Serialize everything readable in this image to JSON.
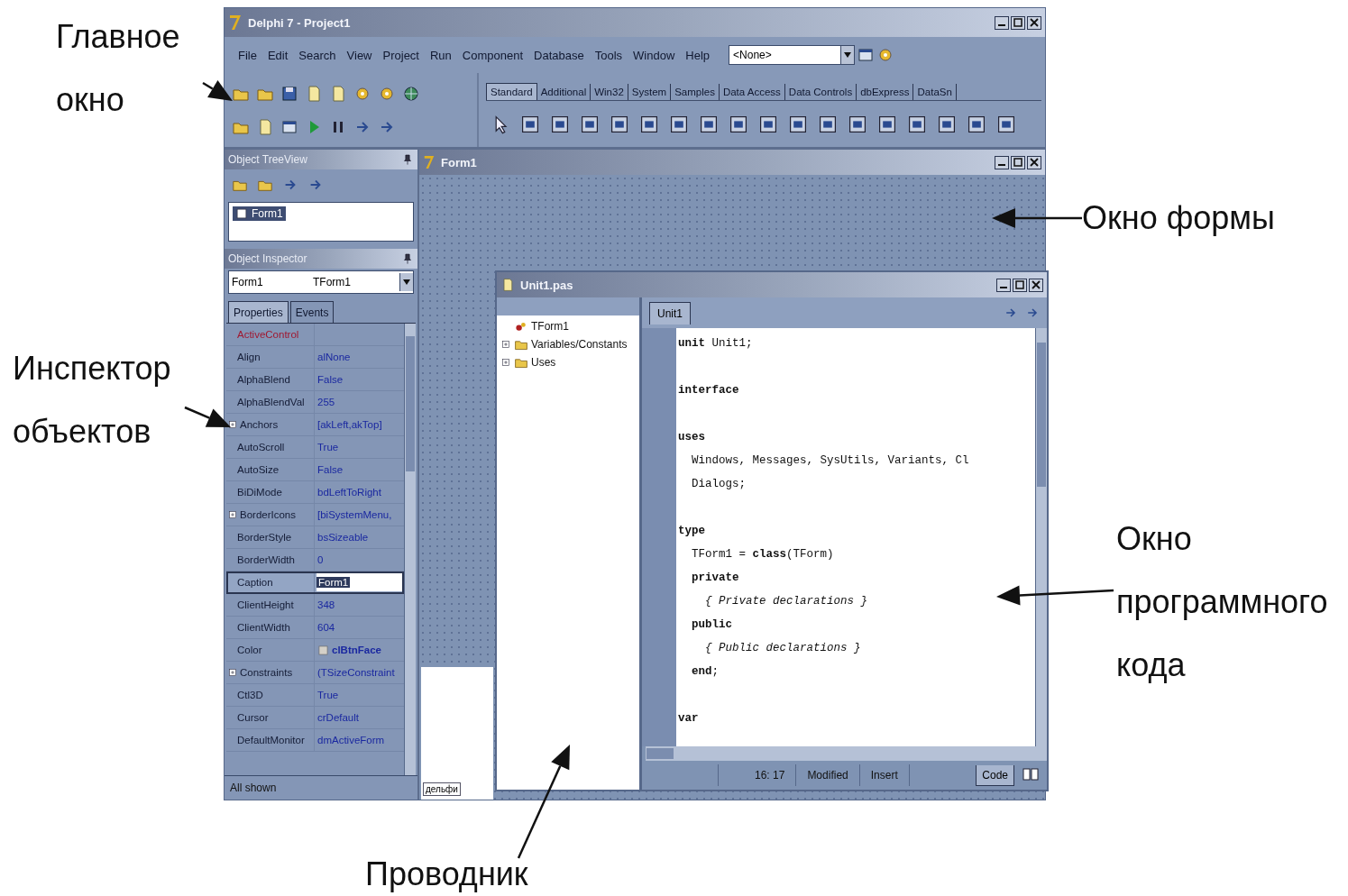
{
  "callouts": [
    {
      "text": "Главное окно",
      "stacked": true
    },
    {
      "text": "Инспектор объектов",
      "stacked": true
    },
    {
      "text": "Окно формы",
      "stacked": false
    },
    {
      "text": "Окно программного кода",
      "stacked": true
    },
    {
      "text": "Проводник"
    }
  ],
  "main_window": {
    "title": "Delphi 7 - Project1",
    "menu": [
      "File",
      "Edit",
      "Search",
      "View",
      "Project",
      "Run",
      "Component",
      "Database",
      "Tools",
      "Window",
      "Help"
    ],
    "combo": "<None>",
    "palette_tabs": [
      {
        "label": "Standard",
        "selected": true
      },
      {
        "label": "Additional",
        "selected": false
      },
      {
        "label": "Win32",
        "selected": false
      },
      {
        "label": "System",
        "selected": false
      },
      {
        "label": "Samples",
        "selected": false
      },
      {
        "label": "Data Access",
        "selected": false
      },
      {
        "label": "Data Controls",
        "selected": false
      },
      {
        "label": "dbExpress",
        "selected": false
      },
      {
        "label": "DataSn",
        "selected": false
      }
    ]
  },
  "tree_view": {
    "title": "Object TreeView",
    "items": [
      {
        "label": "Form1",
        "selected": true
      }
    ]
  },
  "inspector": {
    "title": "Object Inspector",
    "object": "Form1",
    "object_type": "TForm1",
    "tabs": [
      {
        "label": "Properties",
        "selected": true
      },
      {
        "label": "Events",
        "selected": false
      }
    ],
    "properties": [
      {
        "name": "ActiveControl",
        "kind": "reference",
        "has_children": false,
        "selected": false
      },
      {
        "name": "Align",
        "value": "alNone",
        "kind": "plain",
        "has_children": false,
        "selected": false
      },
      {
        "name": "AlphaBlend",
        "value": "False",
        "kind": "plain",
        "has_children": false,
        "selected": false
      },
      {
        "name": "AlphaBlendVal",
        "value": "255",
        "kind": "plain",
        "has_children": false,
        "selected": false
      },
      {
        "name": "Anchors",
        "value": "[akLeft,akTop]",
        "kind": "plain",
        "has_children": true,
        "selected": false
      },
      {
        "name": "AutoScroll",
        "value": "True",
        "kind": "plain",
        "has_children": false,
        "selected": false
      },
      {
        "name": "AutoSize",
        "value": "False",
        "kind": "plain",
        "has_children": false,
        "selected": false
      },
      {
        "name": "BiDiMode",
        "value": "bdLeftToRight",
        "kind": "plain",
        "has_children": false,
        "selected": false
      },
      {
        "name": "BorderIcons",
        "value": "[biSystemMenu,",
        "kind": "plain",
        "has_children": true,
        "selected": false
      },
      {
        "name": "BorderStyle",
        "value": "bsSizeable",
        "kind": "plain",
        "has_children": false,
        "selected": false
      },
      {
        "name": "BorderWidth",
        "value": "0",
        "kind": "plain",
        "has_children": false,
        "selected": false
      },
      {
        "name": "Caption",
        "value": "Form1",
        "kind": "plain",
        "has_children": false,
        "selected": true
      },
      {
        "name": "ClientHeight",
        "value": "348",
        "kind": "plain",
        "has_children": false,
        "selected": false
      },
      {
        "name": "ClientWidth",
        "value": "604",
        "kind": "plain",
        "has_children": false,
        "selected": false
      },
      {
        "name": "Color",
        "value": "clBtnFace",
        "kind": "color",
        "has_children": false,
        "selected": false
      },
      {
        "name": "Constraints",
        "value": "(TSizeConstraint",
        "kind": "plain",
        "has_children": true,
        "selected": false
      },
      {
        "name": "Ctl3D",
        "value": "True",
        "kind": "plain",
        "has_children": false,
        "selected": false
      },
      {
        "name": "Cursor",
        "value": "crDefault",
        "kind": "plain",
        "has_children": false,
        "selected": false
      },
      {
        "name": "DefaultMonitor",
        "value": "dmActiveForm",
        "kind": "plain",
        "has_children": false,
        "selected": false
      }
    ],
    "status": "All shown"
  },
  "form_window": {
    "title": "Form1",
    "background_tab": "дельфи"
  },
  "editor": {
    "title": "Unit1.pas",
    "explorer": [
      {
        "label": "TForm1",
        "has_children": false
      },
      {
        "label": "Variables/Constants",
        "has_children": true
      },
      {
        "label": "Uses",
        "has_children": true
      }
    ],
    "tabs": [
      {
        "label": "Unit1",
        "selected": true
      }
    ],
    "code_blocks": [
      [
        {
          "text": "**unit** Unit1;",
          "kind": "code"
        }
      ],
      [
        {
          "text": "**interface**",
          "kind": "code"
        }
      ],
      [
        {
          "text": "**uses**",
          "kind": "code"
        },
        {
          "text": "  Windows, Messages, SysUtils, Variants, Cl",
          "kind": "code"
        },
        {
          "text": "  Dialogs;",
          "kind": "code"
        }
      ],
      [
        {
          "text": "**type**",
          "kind": "code"
        },
        {
          "text": "  TForm1 = **class**(TForm)",
          "kind": "code"
        },
        {
          "text": "  **private**",
          "kind": "code"
        },
        {
          "text": "    { Private declarations }",
          "kind": "comment"
        },
        {
          "text": "  **public**",
          "kind": "code"
        },
        {
          "text": "    { Public declarations }",
          "kind": "comment"
        },
        {
          "text": "  **end**;",
          "kind": "code"
        }
      ],
      [
        {
          "text": "**var**",
          "kind": "code"
        }
      ]
    ],
    "status": {
      "position": "16: 17",
      "modified": "Modified",
      "mode": "Insert"
    },
    "view_tabs": [
      {
        "label": "Code",
        "selected": true
      }
    ]
  }
}
